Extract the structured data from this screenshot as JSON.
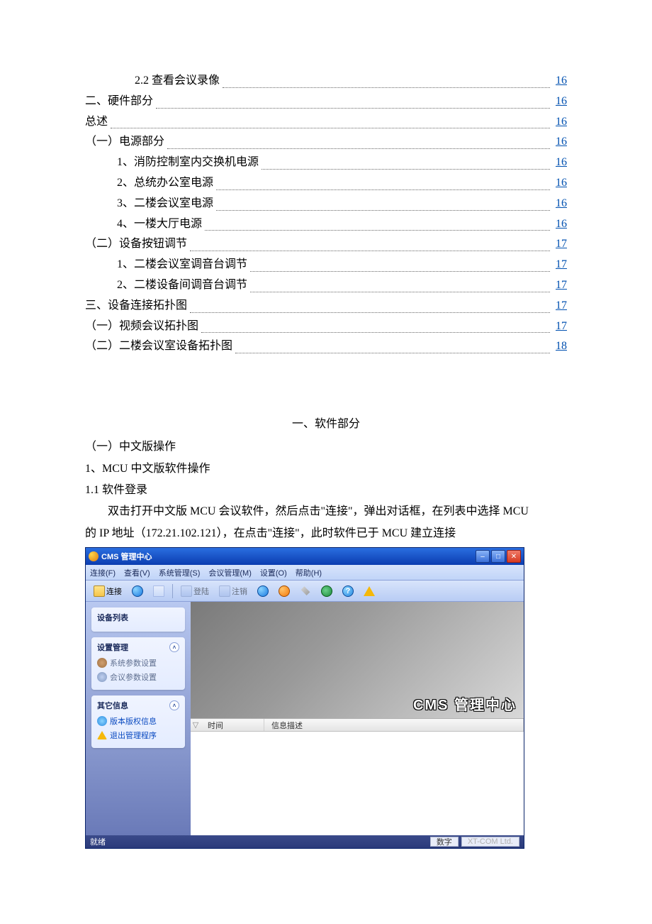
{
  "toc": [
    {
      "label": "2.2 查看会议录像",
      "page": "16",
      "lvl": 2
    },
    {
      "label": "二、硬件部分",
      "page": "16",
      "lvl": 0
    },
    {
      "label": "总述",
      "page": "16",
      "lvl": 0
    },
    {
      "label": "（一）电源部分",
      "page": "16",
      "lvl": 0
    },
    {
      "label": "1、消防控制室内交换机电源",
      "page": "16",
      "lvl": 1
    },
    {
      "label": "2、总统办公室电源",
      "page": "16",
      "lvl": 1
    },
    {
      "label": "3、二楼会议室电源",
      "page": "16",
      "lvl": 1
    },
    {
      "label": "4、一楼大厅电源",
      "page": "16",
      "lvl": 1
    },
    {
      "label": "（二）设备按钮调节",
      "page": "17",
      "lvl": 0
    },
    {
      "label": "1、二楼会议室调音台调节",
      "page": "17",
      "lvl": 1
    },
    {
      "label": "2、二楼设备间调音台调节",
      "page": "17",
      "lvl": 1
    },
    {
      "label": "三、设备连接拓扑图",
      "page": "17",
      "lvl": 0
    },
    {
      "label": "（一）视频会议拓扑图",
      "page": "17",
      "lvl": 0
    },
    {
      "label": "（二）二楼会议室设备拓扑图",
      "page": "18",
      "lvl": 0
    }
  ],
  "section": {
    "title": "一、软件部分",
    "h1": "（一）中文版操作",
    "h2": "1、MCU 中文版软件操作",
    "h3": "1.1 软件登录",
    "p1": "双击打开中文版 MCU 会议软件，然后点击\"连接\"，弹出对话框，在列表中选择 MCU",
    "p2": "的 IP 地址（172.21.102.121），在点击\"连接\"，此时软件已于 MCU 建立连接"
  },
  "app": {
    "title": "CMS 管理中心",
    "menu": {
      "connect": "连接(F)",
      "view": "查看(V)",
      "sysmgmt": "系统管理(S)",
      "confmgmt": "会议管理(M)",
      "settings": "设置(O)",
      "help": "帮助(H)"
    },
    "toolbar": {
      "connect": "连接",
      "login": "登陆",
      "register": "注销"
    },
    "sidebar": {
      "p1": {
        "title": "设备列表"
      },
      "p2": {
        "title": "设置管理",
        "i1": "系统参数设置",
        "i2": "会议参数设置"
      },
      "p3": {
        "title": "其它信息",
        "i1": "版本版权信息",
        "i2": "退出管理程序"
      }
    },
    "brand": "CMS 管理中心",
    "log": {
      "col1": "时间",
      "col2": "信息描述"
    },
    "status": {
      "ready": "就绪",
      "num": "数字",
      "company": "XT-COM  Ltd."
    }
  }
}
